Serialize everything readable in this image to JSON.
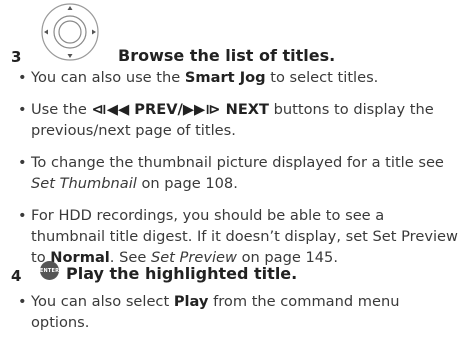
{
  "step3": {
    "number": "3",
    "title": "Browse the list of titles.",
    "icon": "dpad-icon",
    "bullets": [
      {
        "a": "You can also use the ",
        "b": "Smart Jog",
        "c": " to select titles."
      },
      {
        "a": "Use the ",
        "b": "⧏◀◀ PREV/▶▶⧐ NEXT",
        "c": " buttons to display the previous/next page of titles."
      },
      {
        "a": "To change the thumbnail picture displayed for a title see ",
        "i": "Set Thumbnail",
        "c": " on page 108."
      },
      {
        "a": "For HDD recordings, you should be able to see a thumbnail title digest. If it doesn’t display, set Set Preview to ",
        "b": "Normal",
        "c": ". See ",
        "i": "Set Preview",
        "d": " on page 145."
      }
    ]
  },
  "step4": {
    "number": "4",
    "title": "Play the highlighted title.",
    "icon": "enter-button-icon",
    "icon_label": "ENTER",
    "bullets": [
      {
        "a": "You can also select ",
        "b": "Play",
        "c": " from the command menu options."
      }
    ]
  }
}
